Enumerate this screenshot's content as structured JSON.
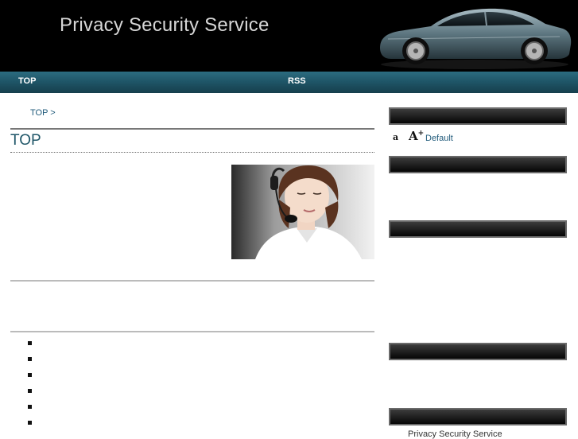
{
  "header": {
    "title": "Privacy Security Service"
  },
  "nav": {
    "items": [
      {
        "label": "TOP"
      },
      {
        "label": "RSS"
      }
    ]
  },
  "breadcrumb": {
    "label": "TOP >"
  },
  "main": {
    "title": "TOP",
    "bullet_count": 6
  },
  "sidebar": {
    "font_size": {
      "small_label": "a",
      "large_label": "A",
      "plus": "+",
      "default_label": "Default"
    },
    "link_text": "Privacy Security Service"
  },
  "colors": {
    "nav_bar": "#1f5668",
    "link": "#1f5a7a",
    "header_bg": "#000000"
  },
  "icons": {
    "decrease_font": "font-decrease-icon",
    "increase_font": "font-increase-icon"
  }
}
